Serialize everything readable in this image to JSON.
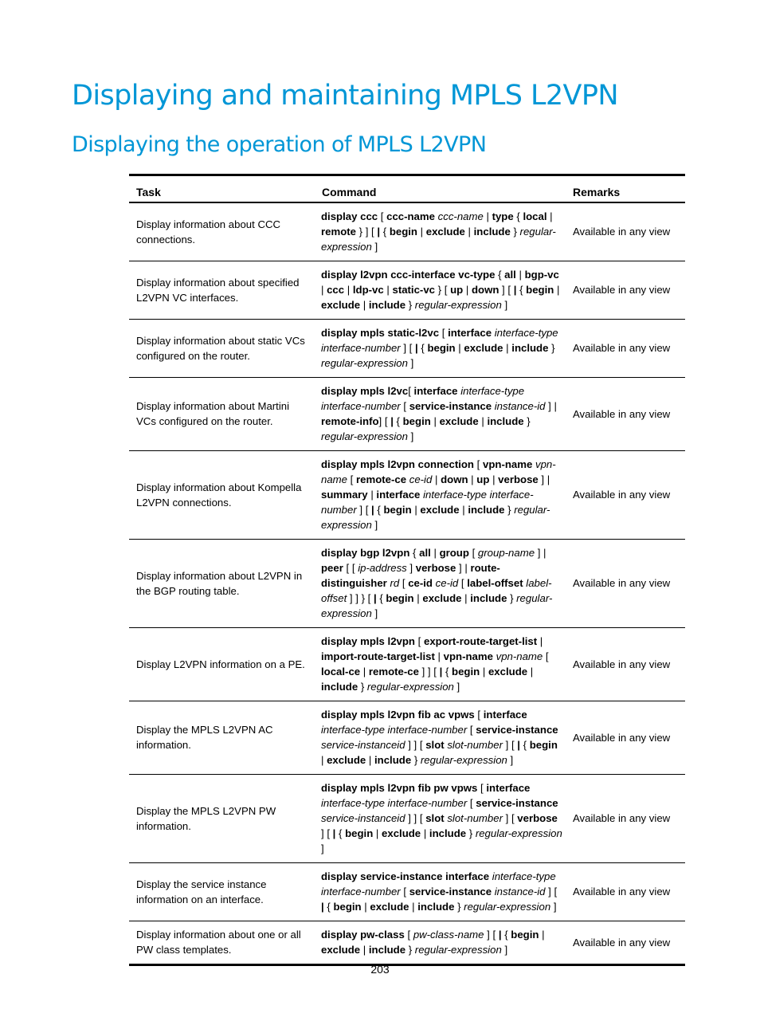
{
  "document": {
    "title": "Displaying and maintaining MPLS L2VPN",
    "section_title": "Displaying the operation of MPLS L2VPN",
    "page_number": "203",
    "accent_color": "#0096d6"
  },
  "table": {
    "headers": {
      "task": "Task",
      "command": "Command",
      "remarks": "Remarks"
    },
    "rows": [
      {
        "task": "Display information about CCC connections.",
        "command": [
          [
            "b",
            "display ccc"
          ],
          [
            "t",
            " [ "
          ],
          [
            "b",
            "ccc-name"
          ],
          [
            "t",
            " "
          ],
          [
            "i",
            "ccc-name"
          ],
          [
            "t",
            " | "
          ],
          [
            "b",
            "type"
          ],
          [
            "t",
            " { "
          ],
          [
            "b",
            "local"
          ],
          [
            "t",
            " | "
          ],
          [
            "b",
            "remote"
          ],
          [
            "t",
            " } ] [ "
          ],
          [
            "b",
            "|"
          ],
          [
            "t",
            " { "
          ],
          [
            "b",
            "begin"
          ],
          [
            "t",
            " | "
          ],
          [
            "b",
            "exclude"
          ],
          [
            "t",
            " | "
          ],
          [
            "b",
            "include"
          ],
          [
            "t",
            " } "
          ],
          [
            "i",
            "regular-expression"
          ],
          [
            "t",
            " ]"
          ]
        ],
        "remarks": "Available in any view"
      },
      {
        "task": "Display information about specified L2VPN VC interfaces.",
        "command": [
          [
            "b",
            "display l2vpn ccc-interface vc-type"
          ],
          [
            "t",
            " { "
          ],
          [
            "b",
            "all"
          ],
          [
            "t",
            " | "
          ],
          [
            "b",
            "bgp-vc"
          ],
          [
            "t",
            " | "
          ],
          [
            "b",
            "ccc"
          ],
          [
            "t",
            " | "
          ],
          [
            "b",
            "ldp-vc"
          ],
          [
            "t",
            " | "
          ],
          [
            "b",
            "static-vc"
          ],
          [
            "t",
            " } [ "
          ],
          [
            "b",
            "up"
          ],
          [
            "t",
            " | "
          ],
          [
            "b",
            "down"
          ],
          [
            "t",
            " ] [ "
          ],
          [
            "b",
            "|"
          ],
          [
            "t",
            " { "
          ],
          [
            "b",
            "begin"
          ],
          [
            "t",
            " | "
          ],
          [
            "b",
            "exclude"
          ],
          [
            "t",
            " | "
          ],
          [
            "b",
            "include"
          ],
          [
            "t",
            " } "
          ],
          [
            "i",
            "regular-expression"
          ],
          [
            "t",
            " ]"
          ]
        ],
        "remarks": "Available in any view"
      },
      {
        "task": "Display information about static VCs configured on the router.",
        "command": [
          [
            "b",
            "display mpls static-l2vc"
          ],
          [
            "t",
            " [ "
          ],
          [
            "b",
            "interface"
          ],
          [
            "t",
            " "
          ],
          [
            "i",
            "interface-type interface-number"
          ],
          [
            "t",
            " ] [ "
          ],
          [
            "b",
            "|"
          ],
          [
            "t",
            " { "
          ],
          [
            "b",
            "begin"
          ],
          [
            "t",
            " | "
          ],
          [
            "b",
            "exclude"
          ],
          [
            "t",
            " | "
          ],
          [
            "b",
            "include"
          ],
          [
            "t",
            " } "
          ],
          [
            "i",
            "regular-expression"
          ],
          [
            "t",
            " ]"
          ]
        ],
        "remarks": "Available in any view"
      },
      {
        "task": "Display information about Martini VCs configured on the router.",
        "command": [
          [
            "b",
            "display mpls l2vc"
          ],
          [
            "t",
            "[ "
          ],
          [
            "b",
            "interface"
          ],
          [
            "t",
            " "
          ],
          [
            "i",
            "interface-type interface-number"
          ],
          [
            "t",
            " [ "
          ],
          [
            "b",
            "service-instance"
          ],
          [
            "t",
            " "
          ],
          [
            "i",
            "instance-id"
          ],
          [
            "t",
            " ] | "
          ],
          [
            "b",
            "remote-info"
          ],
          [
            "t",
            "] [ "
          ],
          [
            "b",
            "|"
          ],
          [
            "t",
            " { "
          ],
          [
            "b",
            "begin"
          ],
          [
            "t",
            " | "
          ],
          [
            "b",
            "exclude"
          ],
          [
            "t",
            " | "
          ],
          [
            "b",
            "include"
          ],
          [
            "t",
            " } "
          ],
          [
            "i",
            "regular-expression"
          ],
          [
            "t",
            " ]"
          ]
        ],
        "remarks": "Available in any view"
      },
      {
        "task": "Display information about Kompella L2VPN connections.",
        "command": [
          [
            "b",
            "display mpls l2vpn connection"
          ],
          [
            "t",
            " [ "
          ],
          [
            "b",
            "vpn-name"
          ],
          [
            "t",
            " "
          ],
          [
            "i",
            "vpn-name"
          ],
          [
            "t",
            " [ "
          ],
          [
            "b",
            "remote-ce"
          ],
          [
            "t",
            " "
          ],
          [
            "i",
            "ce-id"
          ],
          [
            "t",
            " | "
          ],
          [
            "b",
            "down"
          ],
          [
            "t",
            " | "
          ],
          [
            "b",
            "up"
          ],
          [
            "t",
            " | "
          ],
          [
            "b",
            "verbose"
          ],
          [
            "t",
            " ] | "
          ],
          [
            "b",
            "summary"
          ],
          [
            "t",
            " | "
          ],
          [
            "b",
            "interface"
          ],
          [
            "t",
            " "
          ],
          [
            "i",
            "interface-type interface-number"
          ],
          [
            "t",
            " ] [ "
          ],
          [
            "b",
            "|"
          ],
          [
            "t",
            " { "
          ],
          [
            "b",
            "begin"
          ],
          [
            "t",
            " | "
          ],
          [
            "b",
            "exclude"
          ],
          [
            "t",
            " | "
          ],
          [
            "b",
            "include"
          ],
          [
            "t",
            " } "
          ],
          [
            "i",
            "regular-expression"
          ],
          [
            "t",
            " ]"
          ]
        ],
        "remarks": "Available in any view"
      },
      {
        "task": "Display information about L2VPN in the BGP routing table.",
        "command": [
          [
            "b",
            "display bgp l2vpn"
          ],
          [
            "t",
            " { "
          ],
          [
            "b",
            "all"
          ],
          [
            "t",
            " | "
          ],
          [
            "b",
            "group"
          ],
          [
            "t",
            " [ "
          ],
          [
            "i",
            "group-name"
          ],
          [
            "t",
            " ] | "
          ],
          [
            "b",
            "peer"
          ],
          [
            "t",
            " [ [ "
          ],
          [
            "i",
            "ip-address"
          ],
          [
            "t",
            " ] "
          ],
          [
            "b",
            "verbose"
          ],
          [
            "t",
            " ] | "
          ],
          [
            "b",
            "route-distinguisher"
          ],
          [
            "t",
            " "
          ],
          [
            "i",
            "rd"
          ],
          [
            "t",
            " [ "
          ],
          [
            "b",
            "ce-id"
          ],
          [
            "t",
            " "
          ],
          [
            "i",
            "ce-id"
          ],
          [
            "t",
            " [ "
          ],
          [
            "b",
            "label-offset"
          ],
          [
            "t",
            " "
          ],
          [
            "i",
            "label-offset"
          ],
          [
            "t",
            " ] ] } [ "
          ],
          [
            "b",
            "|"
          ],
          [
            "t",
            " { "
          ],
          [
            "b",
            "begin"
          ],
          [
            "t",
            " | "
          ],
          [
            "b",
            "exclude"
          ],
          [
            "t",
            " | "
          ],
          [
            "b",
            "include"
          ],
          [
            "t",
            " } "
          ],
          [
            "i",
            "regular-expression"
          ],
          [
            "t",
            " ]"
          ]
        ],
        "remarks": "Available in any view"
      },
      {
        "task": "Display L2VPN information on a PE.",
        "command": [
          [
            "b",
            "display mpls l2vpn"
          ],
          [
            "t",
            " [ "
          ],
          [
            "b",
            "export-route-target-list"
          ],
          [
            "t",
            " | "
          ],
          [
            "b",
            "import-route-target-list"
          ],
          [
            "t",
            " | "
          ],
          [
            "b",
            "vpn-name"
          ],
          [
            "t",
            " "
          ],
          [
            "i",
            "vpn-name"
          ],
          [
            "t",
            " [ "
          ],
          [
            "b",
            "local-ce"
          ],
          [
            "t",
            " | "
          ],
          [
            "b",
            "remote-ce"
          ],
          [
            "t",
            " ] ] [ "
          ],
          [
            "b",
            "|"
          ],
          [
            "t",
            " { "
          ],
          [
            "b",
            "begin"
          ],
          [
            "t",
            " | "
          ],
          [
            "b",
            "exclude"
          ],
          [
            "t",
            " | "
          ],
          [
            "b",
            "include"
          ],
          [
            "t",
            " } "
          ],
          [
            "i",
            "regular-expression"
          ],
          [
            "t",
            " ]"
          ]
        ],
        "remarks": "Available in any view"
      },
      {
        "task": "Display the MPLS L2VPN AC information.",
        "command": [
          [
            "b",
            "display mpls l2vpn fib ac vpws"
          ],
          [
            "t",
            " [ "
          ],
          [
            "b",
            "interface"
          ],
          [
            "t",
            " "
          ],
          [
            "i",
            "interface-type interface-number"
          ],
          [
            "t",
            " [ "
          ],
          [
            "b",
            "service-instance"
          ],
          [
            "t",
            " "
          ],
          [
            "i",
            "service-instanceid"
          ],
          [
            "t",
            " ] ] [ "
          ],
          [
            "b",
            "slot"
          ],
          [
            "t",
            " "
          ],
          [
            "i",
            "slot-number"
          ],
          [
            "t",
            " ] [ "
          ],
          [
            "b",
            "|"
          ],
          [
            "t",
            " { "
          ],
          [
            "b",
            "begin"
          ],
          [
            "t",
            " | "
          ],
          [
            "b",
            "exclude"
          ],
          [
            "t",
            " | "
          ],
          [
            "b",
            "include"
          ],
          [
            "t",
            " } "
          ],
          [
            "i",
            "regular-expression"
          ],
          [
            "t",
            " ]"
          ]
        ],
        "remarks": "Available in any view"
      },
      {
        "task": "Display the MPLS L2VPN PW information.",
        "command": [
          [
            "b",
            "display mpls l2vpn fib pw vpws"
          ],
          [
            "t",
            " [ "
          ],
          [
            "b",
            "interface"
          ],
          [
            "t",
            " "
          ],
          [
            "i",
            "interface-type interface-number"
          ],
          [
            "t",
            " [ "
          ],
          [
            "b",
            "service-instance"
          ],
          [
            "t",
            " "
          ],
          [
            "i",
            "service-instanceid"
          ],
          [
            "t",
            " ] ] [ "
          ],
          [
            "b",
            "slot"
          ],
          [
            "t",
            " "
          ],
          [
            "i",
            "slot-number"
          ],
          [
            "t",
            " ] [ "
          ],
          [
            "b",
            "verbose"
          ],
          [
            "t",
            " ] [ "
          ],
          [
            "b",
            "|"
          ],
          [
            "t",
            " { "
          ],
          [
            "b",
            "begin"
          ],
          [
            "t",
            " | "
          ],
          [
            "b",
            "exclude"
          ],
          [
            "t",
            " | "
          ],
          [
            "b",
            "include"
          ],
          [
            "t",
            " } "
          ],
          [
            "i",
            "regular-expression"
          ],
          [
            "t",
            " ]"
          ]
        ],
        "remarks": "Available in any view"
      },
      {
        "task": "Display the service instance information on an interface.",
        "command": [
          [
            "b",
            "display service-instance interface"
          ],
          [
            "t",
            " "
          ],
          [
            "i",
            "interface-type interface-number"
          ],
          [
            "t",
            " [ "
          ],
          [
            "b",
            "service-instance"
          ],
          [
            "t",
            " "
          ],
          [
            "i",
            "instance-id"
          ],
          [
            "t",
            " ] [ "
          ],
          [
            "b",
            "|"
          ],
          [
            "t",
            " { "
          ],
          [
            "b",
            "begin"
          ],
          [
            "t",
            " | "
          ],
          [
            "b",
            "exclude"
          ],
          [
            "t",
            " | "
          ],
          [
            "b",
            "include"
          ],
          [
            "t",
            " } "
          ],
          [
            "i",
            "regular-expression"
          ],
          [
            "t",
            " ]"
          ]
        ],
        "remarks": "Available in any view"
      },
      {
        "task": "Display information about one or all PW class templates.",
        "command": [
          [
            "b",
            "display pw-class"
          ],
          [
            "t",
            " [ "
          ],
          [
            "i",
            "pw-class-name"
          ],
          [
            "t",
            " ] [ "
          ],
          [
            "b",
            "|"
          ],
          [
            "t",
            " { "
          ],
          [
            "b",
            "begin"
          ],
          [
            "t",
            " | "
          ],
          [
            "b",
            "exclude"
          ],
          [
            "t",
            " | "
          ],
          [
            "b",
            "include"
          ],
          [
            "t",
            " } "
          ],
          [
            "i",
            "regular-expression"
          ],
          [
            "t",
            " ]"
          ]
        ],
        "remarks": "Available in any view"
      }
    ]
  }
}
